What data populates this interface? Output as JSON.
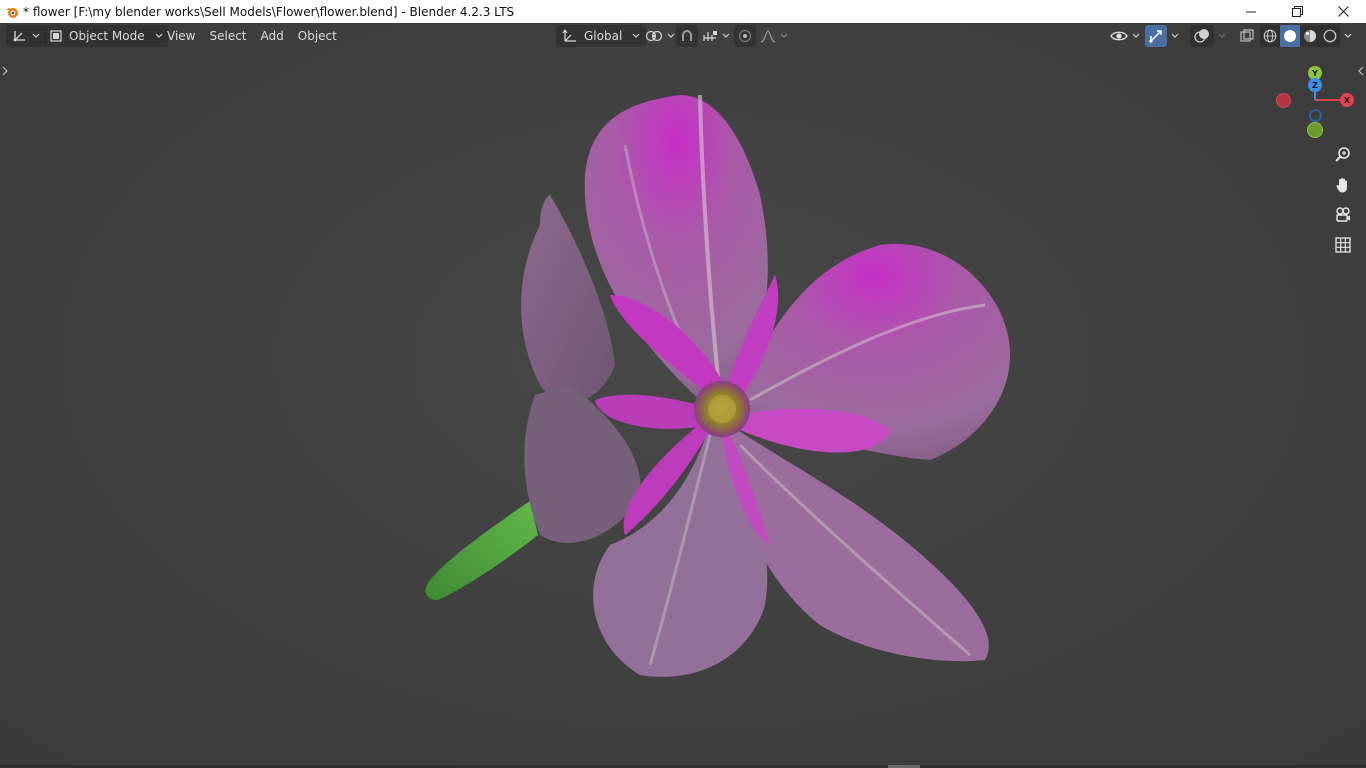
{
  "window": {
    "title": "* flower [F:\\my blender works\\Sell Models\\Flower\\flower.blend] - Blender 4.2.3 LTS",
    "controls": [
      "minimize-icon",
      "restore-icon",
      "close-icon"
    ]
  },
  "header": {
    "editor_type_icon": "axis-editor-icon",
    "mode": {
      "label": "Object Mode",
      "icon": "object-mode-icon"
    },
    "menus": [
      "View",
      "Select",
      "Add",
      "Object"
    ],
    "transform_orientation": {
      "label": "Global",
      "icon": "orientation-icon"
    },
    "pivot_icon": "pivot-point-icon",
    "snap_icon": "magnet-icon",
    "snap_target_icon": "snap-increment-icon",
    "proportional_edit_icon": "proportional-edit-icon",
    "falloff_icon": "falloff-curve-icon",
    "visibility_icon": "eye-icon",
    "gizmo_toggle_icon": "gizmo-icon",
    "overlay_icon": "overlay-icon",
    "xray_icon": "xray-icon",
    "shading_modes": [
      "wireframe-icon",
      "solid-icon",
      "material-preview-icon",
      "rendered-icon"
    ],
    "active_shading": "solid"
  },
  "gizmo": {
    "axes": [
      {
        "label": "Y",
        "color": "#8cc63f"
      },
      {
        "label": "Z",
        "color": "#3b8fe8"
      },
      {
        "label": "X",
        "color": "#e0424f"
      }
    ]
  },
  "nav_tools": [
    "zoom-icon",
    "pan-hand-icon",
    "camera-view-icon",
    "ortho-grid-icon"
  ],
  "colors": {
    "accent": "#4a6fa5",
    "viewport_bg": "#414141",
    "petal": "#b36ab4",
    "petal_center": "#c72fc7",
    "stem": "#4fa23a",
    "pollen": "#b7a03a"
  }
}
